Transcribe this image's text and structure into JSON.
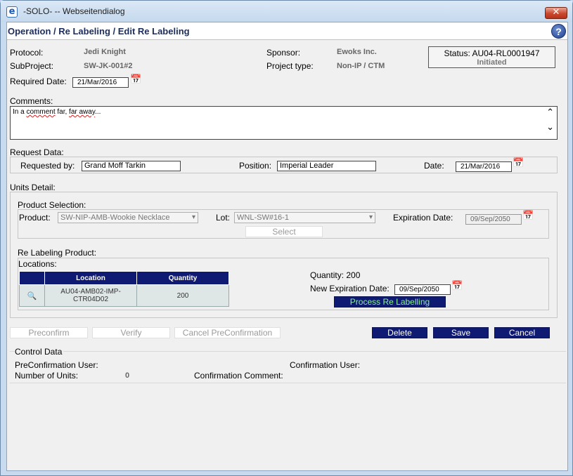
{
  "window": {
    "title": "-SOLO- -- Webseitendialog",
    "close_symbol": "✕",
    "app_icon": "ie-icon"
  },
  "page": {
    "breadcrumb": "Operation / Re Labeling / Edit Re Labeling",
    "help_symbol": "?"
  },
  "header": {
    "protocol_label": "Protocol:",
    "protocol_value": "Jedi Knight",
    "subproject_label": "SubProject:",
    "subproject_value": "SW-JK-001#2",
    "sponsor_label": "Sponsor:",
    "sponsor_value": "Ewoks Inc.",
    "project_type_label": "Project type:",
    "project_type_value": "Non-IP / CTM",
    "status_line": "Status: AU04-RL0001947",
    "status_state": "Initiated",
    "required_date_label": "Required Date:",
    "required_date_value": "21/Mar/2016"
  },
  "comments": {
    "label": "Comments:",
    "text_prefix": "In a ",
    "text_misspelled": "comment",
    "text_mid": " far, ",
    "text_misspelled2": "far away",
    "text_suffix": "..."
  },
  "request_data": {
    "section_label": "Request Data:",
    "requested_by_label": "Requested by:",
    "requested_by_value": "Grand Moff Tarkin",
    "position_label": "Position:",
    "position_value": "Imperial Leader",
    "date_label": "Date:",
    "date_value": "21/Mar/2016"
  },
  "units_detail": {
    "section_label": "Units Detail:",
    "product_selection_label": "Product Selection:",
    "product_label": "Product:",
    "product_value": "SW-NIP-AMB-Wookie Necklace",
    "lot_label": "Lot:",
    "lot_value": "WNL-SW#16-1",
    "expiration_label": "Expiration Date:",
    "expiration_value": "09/Sep/2050",
    "select_button": "Select",
    "relabeling_product_label": "Re Labeling Product:",
    "locations_label": "Locations:",
    "table": {
      "columns": [
        "Location",
        "Quantity"
      ],
      "rows": [
        {
          "location": "AU04-AMB02-IMP-CTR04D02",
          "quantity": "200"
        }
      ]
    },
    "quantity_text": "Quantity: 200",
    "new_expiration_label": "New Expiration Date:",
    "new_expiration_value": "09/Sep/2050",
    "process_button": "Process Re Labelling"
  },
  "actions": {
    "preconfirm": "Preconfirm",
    "verify": "Verify",
    "cancel_preconfirmation": "Cancel PreConfirmation",
    "delete": "Delete",
    "save": "Save",
    "cancel": "Cancel"
  },
  "control_data": {
    "section_label": "Control Data",
    "preconfirmation_user_label": "PreConfirmation User:",
    "confirmation_user_label": "Confirmation User:",
    "number_of_units_label": "Number of Units:",
    "number_of_units_value": "0",
    "confirmation_comment_label": "Confirmation Comment:"
  },
  "icons": {
    "calendar": "calendar-icon",
    "magnifier": "magnifier-icon"
  },
  "colors": {
    "button_blue": "#0f1a73",
    "title_blue": "#1c2d5a",
    "process_text_green": "#8ff09a"
  }
}
